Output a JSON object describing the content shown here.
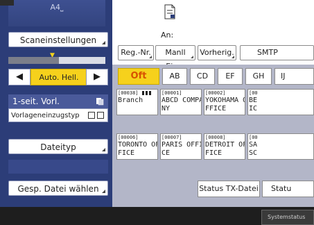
{
  "left_panel": {
    "paper_label": "A4⎵",
    "scan_settings_label": "Scaneinstellungen",
    "density": {
      "level": 0.52
    },
    "left_arrow": "◀",
    "right_arrow": "▶",
    "auto_density_label": "Auto. Hell.",
    "original_side_label": "1-seit. Vorl.",
    "original_feed_label": "Vorlageneinzugstyp",
    "file_type_label": "Dateityp",
    "select_stored_file_label": "Gesp. Datei wählen"
  },
  "content": {
    "an_label": "An:",
    "dest_tabs": [
      "Reg.-Nr.",
      "Manll Eing.",
      "Vorherig.",
      "SMTP"
    ],
    "letter_tabs": [
      "Oft",
      "AB",
      "CD",
      "EF",
      "GH",
      "IJ"
    ],
    "destinations": [
      {
        "number": "[00038]",
        "line1": "Branch",
        "line2": ""
      },
      {
        "number": "[00001]",
        "line1": "ABCD COMPA",
        "line2": "NY"
      },
      {
        "number": "[00002]",
        "line1": "YOKOHAMA O",
        "line2": "FFICE"
      },
      {
        "number": "[00",
        "line1": "BE",
        "line2": "IC"
      },
      {
        "number": "[00006]",
        "line1": "TORONTO OF",
        "line2": "FICE"
      },
      {
        "number": "[00007]",
        "line1": "PARIS OFFI",
        "line2": "CE"
      },
      {
        "number": "[00008]",
        "line1": "DETROIT OF",
        "line2": "FICE"
      },
      {
        "number": "[00",
        "line1": "SA",
        "line2": "SC"
      }
    ],
    "status_tx_file_label": "Status TX-Datei",
    "status_label": "Statu"
  },
  "bottom": {
    "system_status_label": "Systemstatus"
  },
  "colors": {
    "panel_navy": "#2c3d78",
    "accent_yellow": "#f6d11c",
    "active_tab_text": "#d85000",
    "content_gray": "#b3b6c8"
  }
}
